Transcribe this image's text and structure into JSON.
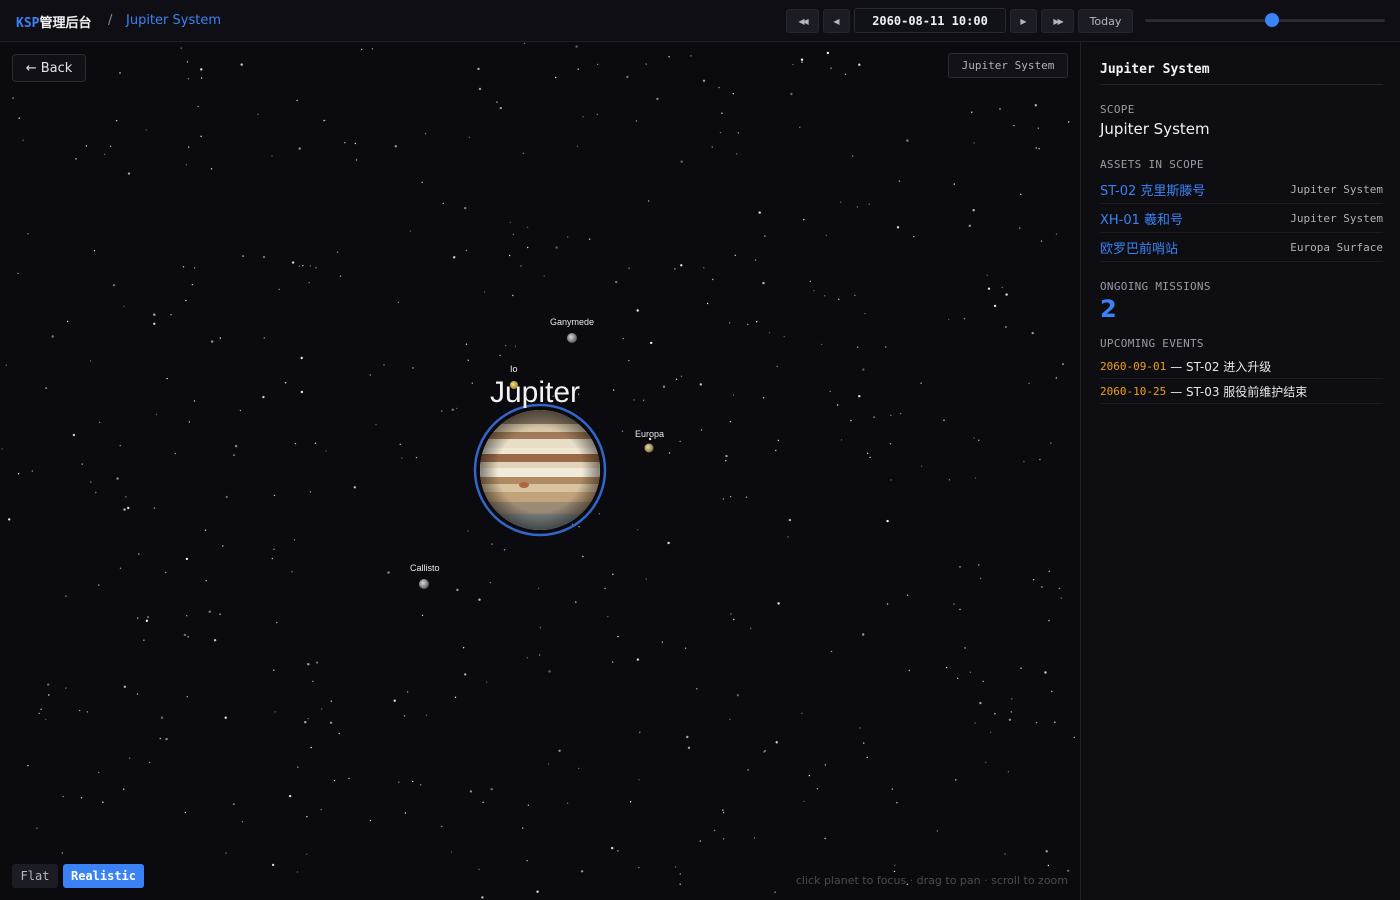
{
  "header": {
    "brand_accent": "KSP",
    "brand_rest": "管理后台",
    "separator": "/",
    "current": "Jupiter System"
  },
  "timebar": {
    "rewind_fast": "◀◀",
    "rewind": "◀",
    "datetime": "2060-08-11 10:00",
    "forward": "▶",
    "forward_fast": "▶▶",
    "today_label": "Today",
    "slider_fraction": 0.53
  },
  "view": {
    "back_label": "← Back",
    "scope_tag": "Jupiter System",
    "planet_name": "Jupiter",
    "moons": [
      {
        "name": "Ganymede"
      },
      {
        "name": "Io"
      },
      {
        "name": "Europa"
      },
      {
        "name": "Callisto"
      }
    ],
    "mode_flat": "Flat",
    "mode_realistic": "Realistic",
    "active_mode": "Realistic",
    "hint": "click planet to focus · drag to pan · scroll to zoom"
  },
  "panel": {
    "title": "Jupiter System",
    "scope_label": "SCOPE",
    "scope_value": "Jupiter System",
    "assets_label": "ASSETS IN SCOPE",
    "assets": [
      {
        "name": "ST-02 克里斯滕号",
        "location": "Jupiter System"
      },
      {
        "name": "XH-01 羲和号",
        "location": "Jupiter System"
      },
      {
        "name": "欧罗巴前哨站",
        "location": "Europa Surface"
      }
    ],
    "missions_label": "ONGOING MISSIONS",
    "missions_count": "2",
    "events_label": "UPCOMING EVENTS",
    "events": [
      {
        "date": "2060-09-01",
        "text": " — ST-02 进入升级"
      },
      {
        "date": "2060-10-25",
        "text": " — ST-03 服役前维护结束"
      }
    ]
  },
  "colors": {
    "accent": "#3b82f6",
    "event_date": "#f0a020",
    "background": "#0a0a0f"
  }
}
